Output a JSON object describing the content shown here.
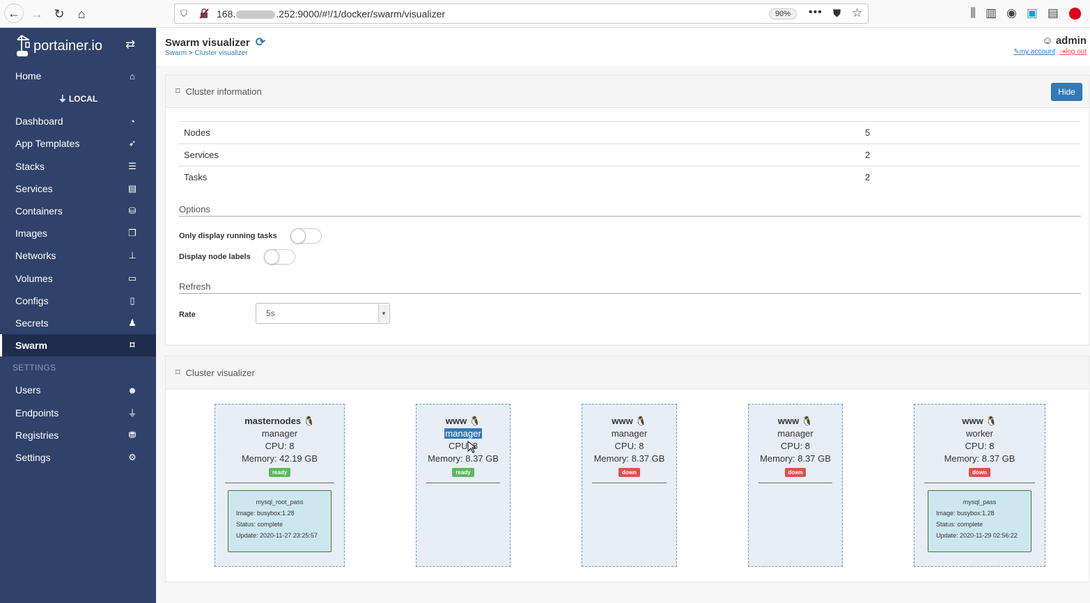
{
  "browser": {
    "url_prefix": "168.",
    "url_suffix": ".252:9000/#!/1/docker/swarm/visualizer",
    "zoom": "90%"
  },
  "sidebar": {
    "logo": "portainer.io",
    "endpoint": "LOCAL",
    "items": [
      {
        "label": "Home",
        "icon": "home-icon"
      },
      {
        "label": "Dashboard",
        "icon": "tachometer-icon"
      },
      {
        "label": "App Templates",
        "icon": "rocket-icon"
      },
      {
        "label": "Stacks",
        "icon": "th-list-icon"
      },
      {
        "label": "Services",
        "icon": "list-alt-icon"
      },
      {
        "label": "Containers",
        "icon": "cubes-icon"
      },
      {
        "label": "Images",
        "icon": "clone-icon"
      },
      {
        "label": "Networks",
        "icon": "sitemap-icon"
      },
      {
        "label": "Volumes",
        "icon": "hdd-icon"
      },
      {
        "label": "Configs",
        "icon": "file-code-icon"
      },
      {
        "label": "Secrets",
        "icon": "user-secret-icon"
      },
      {
        "label": "Swarm",
        "icon": "object-group-icon",
        "active": true
      }
    ],
    "settings_header": "SETTINGS",
    "settings_items": [
      {
        "label": "Users",
        "icon": "users-icon"
      },
      {
        "label": "Endpoints",
        "icon": "plug-icon"
      },
      {
        "label": "Registries",
        "icon": "database-icon"
      },
      {
        "label": "Settings",
        "icon": "cogs-icon"
      }
    ]
  },
  "header": {
    "title": "Swarm visualizer",
    "breadcrumb_link": "Swarm",
    "breadcrumb_sep": " > ",
    "breadcrumb_current": "Cluster visualizer",
    "user": "admin",
    "my_account": "my account",
    "log_out": "log out"
  },
  "cluster_info": {
    "title": "Cluster information",
    "hide_label": "Hide",
    "rows": [
      {
        "label": "Nodes",
        "value": "5"
      },
      {
        "label": "Services",
        "value": "2"
      },
      {
        "label": "Tasks",
        "value": "2"
      }
    ],
    "options_title": "Options",
    "opt_running": "Only display running tasks",
    "opt_labels": "Display node labels",
    "refresh_title": "Refresh",
    "rate_label": "Rate",
    "rate_value": "5s"
  },
  "visualizer": {
    "title": "Cluster visualizer",
    "nodes": [
      {
        "name": "masternodes",
        "role": "manager",
        "cpu": "CPU: 8",
        "memory": "Memory: 42.19 GB",
        "status": "ready",
        "task": {
          "name": "mysql_root_pass",
          "image": "Image: busybox:1.28",
          "status": "Status: complete",
          "update": "Update: 2020-11-27 23:25:57"
        }
      },
      {
        "name": "www",
        "role": "manager",
        "cpu": "CPU: 8",
        "memory": "Memory: 8.37 GB",
        "status": "ready"
      },
      {
        "name": "www",
        "role": "manager",
        "cpu": "CPU: 8",
        "memory": "Memory: 8.37 GB",
        "status": "down"
      },
      {
        "name": "www",
        "role": "manager",
        "cpu": "CPU: 8",
        "memory": "Memory: 8.37 GB",
        "status": "down"
      },
      {
        "name": "www",
        "role": "worker",
        "cpu": "CPU: 8",
        "memory": "Memory: 8.37 GB",
        "status": "down",
        "task": {
          "name": "mysql_pass",
          "image": "Image: busybox:1.28",
          "status": "Status: complete",
          "update": "Update: 2020-11-29 02:56:22"
        }
      }
    ]
  }
}
